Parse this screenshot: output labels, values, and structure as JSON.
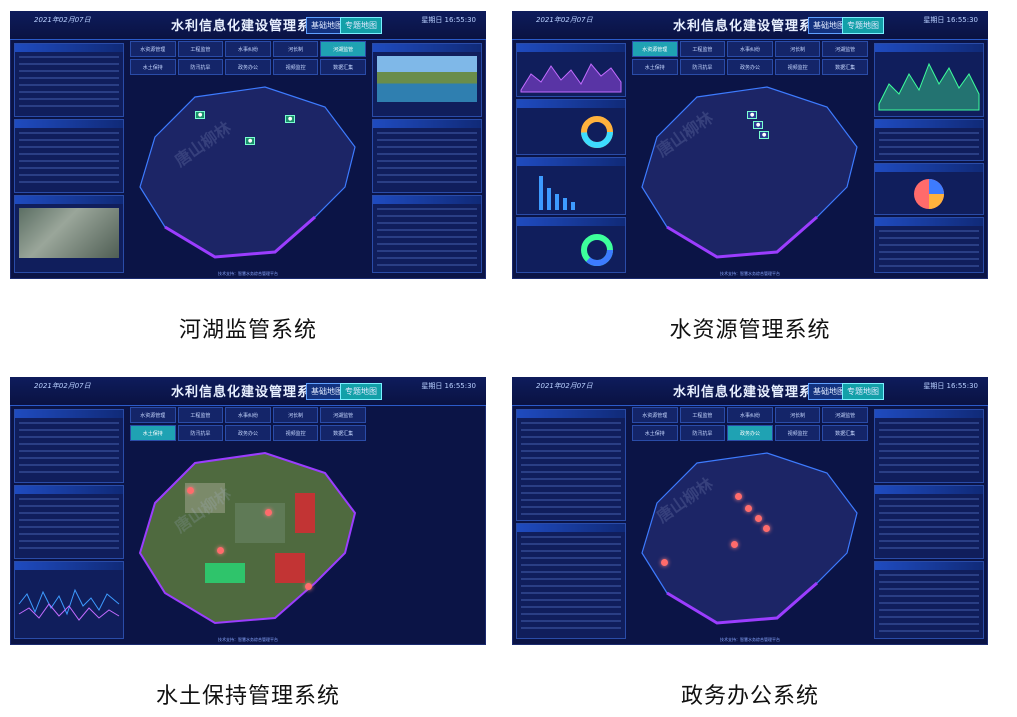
{
  "header": {
    "date": "2021年02月07日",
    "title": "水利信息化建设管理系统",
    "btn_base_map": "基础地图",
    "btn_topic_map": "专题地图",
    "weekday_time": "星期日 16:55:30"
  },
  "footer": "技术支持：智慧水务综合管理平台",
  "watermark": "唐山柳林",
  "nav": [
    "水资源管理",
    "工程监管",
    "水事纠纷",
    "河长制",
    "河湖监管",
    "水土保持",
    "防汛抗旱",
    "政务办公",
    "视频监控",
    "数据汇集"
  ],
  "panels": [
    {
      "caption": "河湖监管系统",
      "active_nav": 4
    },
    {
      "caption": "水资源管理系统",
      "active_nav": 0
    },
    {
      "caption": "水土保持管理系统",
      "active_nav": 5
    },
    {
      "caption": "政务办公系统",
      "active_nav": 7
    }
  ],
  "colors": {
    "accent": "#1fa2b3",
    "panel_bg": "#0b1446",
    "map_fill": "#1c2566"
  }
}
